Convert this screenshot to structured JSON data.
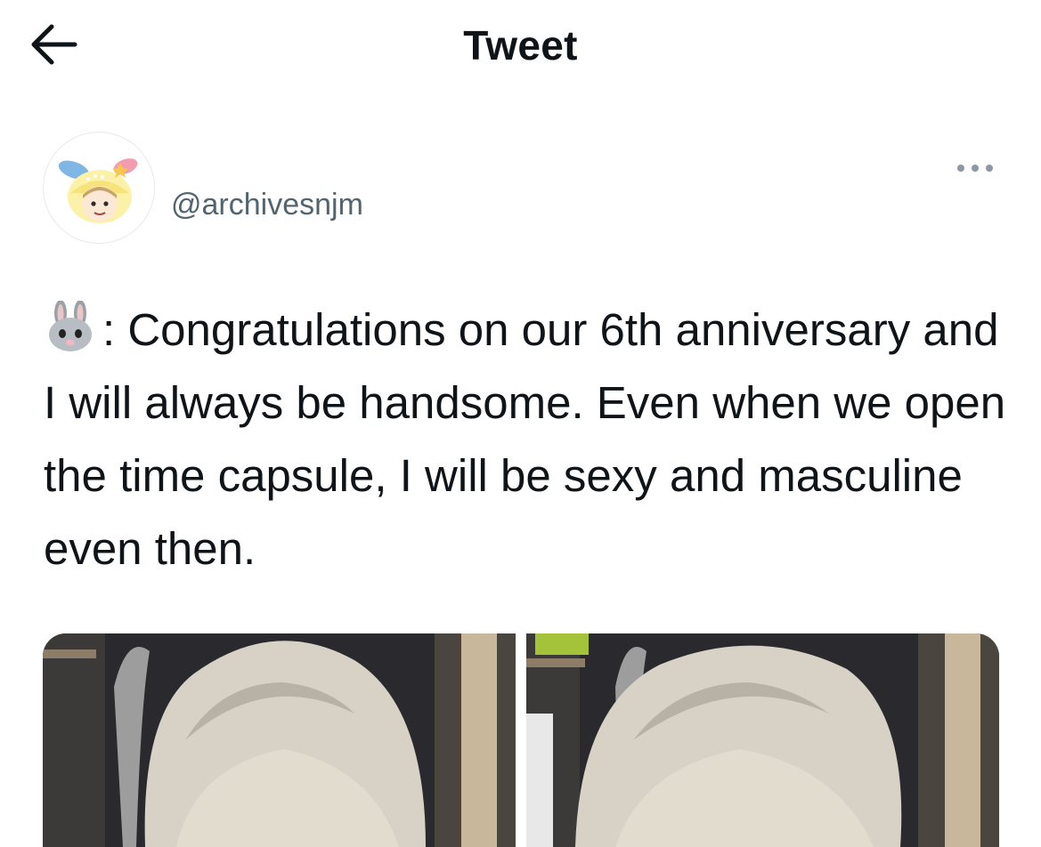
{
  "header": {
    "back_icon": "arrow-left-icon",
    "title": "Tweet"
  },
  "tweet": {
    "handle": "@archivesnjm",
    "avatar_icon": "bunny-hat-avatar",
    "more_icon": "more-horizontal-icon",
    "emoji_icon": "rabbit-face-emoji",
    "text": ": Congratulations on our 6th anniversary and I will always be handsome. Even when we open the time capsule, I will be sexy and masculine even then.",
    "media": [
      {
        "icon": "photo-thumbnail"
      },
      {
        "icon": "photo-thumbnail"
      }
    ]
  },
  "colors": {
    "text_primary": "#0f1419",
    "text_secondary": "#536471",
    "border": "#e6e9ec"
  }
}
